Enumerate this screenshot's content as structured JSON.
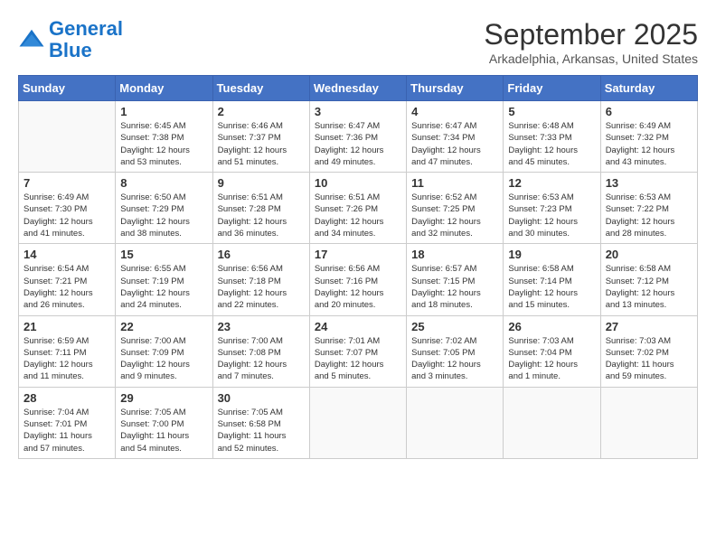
{
  "logo": {
    "line1": "General",
    "line2": "Blue"
  },
  "title": "September 2025",
  "subtitle": "Arkadelphia, Arkansas, United States",
  "days_of_week": [
    "Sunday",
    "Monday",
    "Tuesday",
    "Wednesday",
    "Thursday",
    "Friday",
    "Saturday"
  ],
  "weeks": [
    [
      {
        "day": "",
        "info": ""
      },
      {
        "day": "1",
        "info": "Sunrise: 6:45 AM\nSunset: 7:38 PM\nDaylight: 12 hours\nand 53 minutes."
      },
      {
        "day": "2",
        "info": "Sunrise: 6:46 AM\nSunset: 7:37 PM\nDaylight: 12 hours\nand 51 minutes."
      },
      {
        "day": "3",
        "info": "Sunrise: 6:47 AM\nSunset: 7:36 PM\nDaylight: 12 hours\nand 49 minutes."
      },
      {
        "day": "4",
        "info": "Sunrise: 6:47 AM\nSunset: 7:34 PM\nDaylight: 12 hours\nand 47 minutes."
      },
      {
        "day": "5",
        "info": "Sunrise: 6:48 AM\nSunset: 7:33 PM\nDaylight: 12 hours\nand 45 minutes."
      },
      {
        "day": "6",
        "info": "Sunrise: 6:49 AM\nSunset: 7:32 PM\nDaylight: 12 hours\nand 43 minutes."
      }
    ],
    [
      {
        "day": "7",
        "info": "Sunrise: 6:49 AM\nSunset: 7:30 PM\nDaylight: 12 hours\nand 41 minutes."
      },
      {
        "day": "8",
        "info": "Sunrise: 6:50 AM\nSunset: 7:29 PM\nDaylight: 12 hours\nand 38 minutes."
      },
      {
        "day": "9",
        "info": "Sunrise: 6:51 AM\nSunset: 7:28 PM\nDaylight: 12 hours\nand 36 minutes."
      },
      {
        "day": "10",
        "info": "Sunrise: 6:51 AM\nSunset: 7:26 PM\nDaylight: 12 hours\nand 34 minutes."
      },
      {
        "day": "11",
        "info": "Sunrise: 6:52 AM\nSunset: 7:25 PM\nDaylight: 12 hours\nand 32 minutes."
      },
      {
        "day": "12",
        "info": "Sunrise: 6:53 AM\nSunset: 7:23 PM\nDaylight: 12 hours\nand 30 minutes."
      },
      {
        "day": "13",
        "info": "Sunrise: 6:53 AM\nSunset: 7:22 PM\nDaylight: 12 hours\nand 28 minutes."
      }
    ],
    [
      {
        "day": "14",
        "info": "Sunrise: 6:54 AM\nSunset: 7:21 PM\nDaylight: 12 hours\nand 26 minutes."
      },
      {
        "day": "15",
        "info": "Sunrise: 6:55 AM\nSunset: 7:19 PM\nDaylight: 12 hours\nand 24 minutes."
      },
      {
        "day": "16",
        "info": "Sunrise: 6:56 AM\nSunset: 7:18 PM\nDaylight: 12 hours\nand 22 minutes."
      },
      {
        "day": "17",
        "info": "Sunrise: 6:56 AM\nSunset: 7:16 PM\nDaylight: 12 hours\nand 20 minutes."
      },
      {
        "day": "18",
        "info": "Sunrise: 6:57 AM\nSunset: 7:15 PM\nDaylight: 12 hours\nand 18 minutes."
      },
      {
        "day": "19",
        "info": "Sunrise: 6:58 AM\nSunset: 7:14 PM\nDaylight: 12 hours\nand 15 minutes."
      },
      {
        "day": "20",
        "info": "Sunrise: 6:58 AM\nSunset: 7:12 PM\nDaylight: 12 hours\nand 13 minutes."
      }
    ],
    [
      {
        "day": "21",
        "info": "Sunrise: 6:59 AM\nSunset: 7:11 PM\nDaylight: 12 hours\nand 11 minutes."
      },
      {
        "day": "22",
        "info": "Sunrise: 7:00 AM\nSunset: 7:09 PM\nDaylight: 12 hours\nand 9 minutes."
      },
      {
        "day": "23",
        "info": "Sunrise: 7:00 AM\nSunset: 7:08 PM\nDaylight: 12 hours\nand 7 minutes."
      },
      {
        "day": "24",
        "info": "Sunrise: 7:01 AM\nSunset: 7:07 PM\nDaylight: 12 hours\nand 5 minutes."
      },
      {
        "day": "25",
        "info": "Sunrise: 7:02 AM\nSunset: 7:05 PM\nDaylight: 12 hours\nand 3 minutes."
      },
      {
        "day": "26",
        "info": "Sunrise: 7:03 AM\nSunset: 7:04 PM\nDaylight: 12 hours\nand 1 minute."
      },
      {
        "day": "27",
        "info": "Sunrise: 7:03 AM\nSunset: 7:02 PM\nDaylight: 11 hours\nand 59 minutes."
      }
    ],
    [
      {
        "day": "28",
        "info": "Sunrise: 7:04 AM\nSunset: 7:01 PM\nDaylight: 11 hours\nand 57 minutes."
      },
      {
        "day": "29",
        "info": "Sunrise: 7:05 AM\nSunset: 7:00 PM\nDaylight: 11 hours\nand 54 minutes."
      },
      {
        "day": "30",
        "info": "Sunrise: 7:05 AM\nSunset: 6:58 PM\nDaylight: 11 hours\nand 52 minutes."
      },
      {
        "day": "",
        "info": ""
      },
      {
        "day": "",
        "info": ""
      },
      {
        "day": "",
        "info": ""
      },
      {
        "day": "",
        "info": ""
      }
    ]
  ]
}
